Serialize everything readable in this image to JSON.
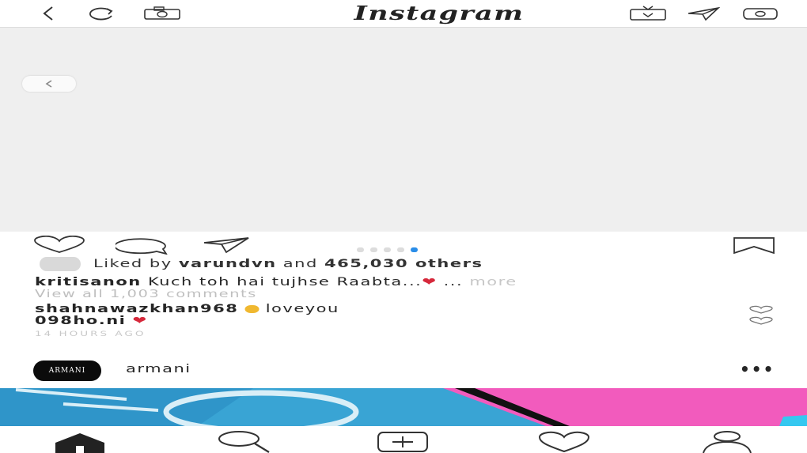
{
  "header": {
    "title": "Instagram",
    "icons": [
      "back-icon",
      "refresh-icon",
      "camera-icon",
      "igtv-icon",
      "direct-message-icon",
      "more-icon"
    ]
  },
  "post": {
    "carousel": {
      "count": 5,
      "active_index": 4
    },
    "likes": {
      "prefix": "Liked by ",
      "user": "varundvn",
      "middle": " and ",
      "count": "465,030 others"
    },
    "caption": {
      "user": "kritisanon",
      "text": " Kuch toh hai tujhse Raabta...",
      "ellipsis": " ... ",
      "more": "more"
    },
    "view_all": "View all 1,003 comments",
    "comment": {
      "user": "shahnawazkhan968",
      "text": " loveyou",
      "line2": "098ho.ni"
    },
    "time": "14 HOURS AGO"
  },
  "next_post": {
    "logo_text": "ARMANI",
    "username": "armani",
    "menu": "•••"
  },
  "colors": {
    "active_dot": "#2a8de8",
    "heart": "#d6283b",
    "media_bg": "#efefef"
  }
}
